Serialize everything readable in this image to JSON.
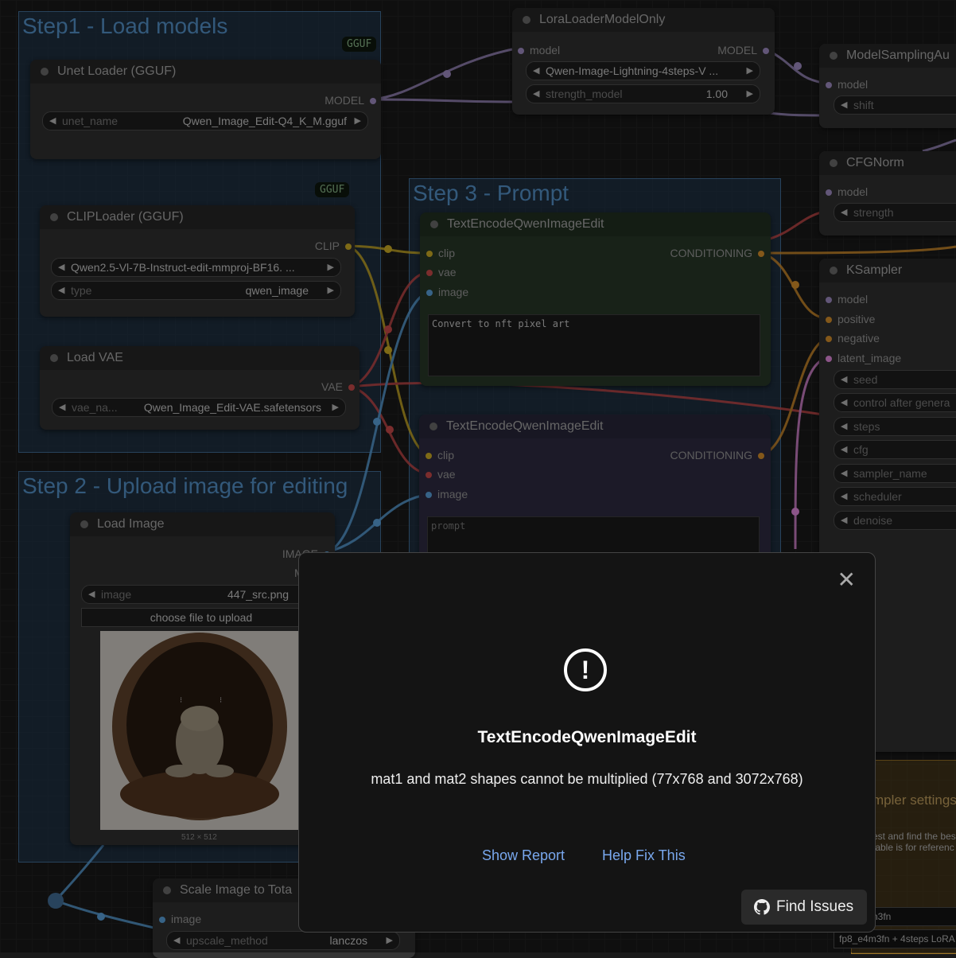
{
  "groups": {
    "step1": "Step1 - Load models",
    "step2": "Step 2 - Upload image for editing",
    "step3": "Step 3 - Prompt",
    "sampler_settings": "mpler settings"
  },
  "unet": {
    "title": "Unet Loader (GGUF)",
    "badge": "GGUF",
    "out": "MODEL",
    "w_label": "unet_name",
    "w_value": "Qwen_Image_Edit-Q4_K_M.gguf"
  },
  "clip": {
    "title": "CLIPLoader (GGUF)",
    "badge": "GGUF",
    "out": "CLIP",
    "w1_value": "Qwen2.5-Vl-7B-Instruct-edit-mmproj-BF16. ...",
    "w2_label": "type",
    "w2_value": "qwen_image"
  },
  "vae": {
    "title": "Load VAE",
    "out": "VAE",
    "w_label": "vae_na...",
    "w_value": "Qwen_Image_Edit-VAE.safetensors"
  },
  "lora": {
    "title": "LoraLoaderModelOnly",
    "in": "model",
    "out": "MODEL",
    "w1_value": "Qwen-Image-Lightning-4steps-V ...",
    "w2_label": "strength_model",
    "w2_value": "1.00"
  },
  "msa": {
    "title": "ModelSamplingAu",
    "in": "model",
    "w_label": "shift"
  },
  "cfgnorm": {
    "title": "CFGNorm",
    "in": "model",
    "w_label": "strength"
  },
  "ksampler": {
    "title": "KSampler",
    "inputs": [
      "model",
      "positive",
      "negative",
      "latent_image"
    ],
    "widgets": [
      "seed",
      "control after genera",
      "steps",
      "cfg",
      "sampler_name",
      "scheduler",
      "denoise"
    ]
  },
  "te1": {
    "title": "TextEncodeQwenImageEdit",
    "inputs": [
      "clip",
      "vae",
      "image"
    ],
    "out": "CONDITIONING",
    "prompt": "Convert to nft pixel art"
  },
  "te2": {
    "title": "TextEncodeQwenImageEdit",
    "inputs": [
      "clip",
      "vae",
      "image"
    ],
    "out": "CONDITIONING",
    "prompt": "prompt"
  },
  "loadimage": {
    "title": "Load Image",
    "out1": "IMAGE",
    "out2": "MA",
    "w_label": "image",
    "w_value": "447_src.png",
    "upload": "choose file to upload",
    "size": "512 × 512"
  },
  "scale": {
    "title": "Scale Image to Tota",
    "in": "image",
    "w_label": "upscale_method",
    "w_value": "lanczos"
  },
  "notes": {
    "line1": "est and find the bes",
    "line2": "table is for referenc",
    "line3": "n3fn",
    "line4": "fp8_e4m3fn + 4steps LoRA"
  },
  "dialog": {
    "title": "TextEncodeQwenImageEdit",
    "message": "mat1 and mat2 shapes cannot be multiplied (77x768 and 3072x768)",
    "show_report": "Show Report",
    "help_fix": "Help Fix This",
    "find_issues": "Find Issues"
  },
  "colors": {
    "model": "#b39ddb",
    "clip": "#e6c229",
    "vae": "#e05252",
    "image": "#64b5f6",
    "conditioning": "#f0a030",
    "latent": "#ff9cf9"
  }
}
